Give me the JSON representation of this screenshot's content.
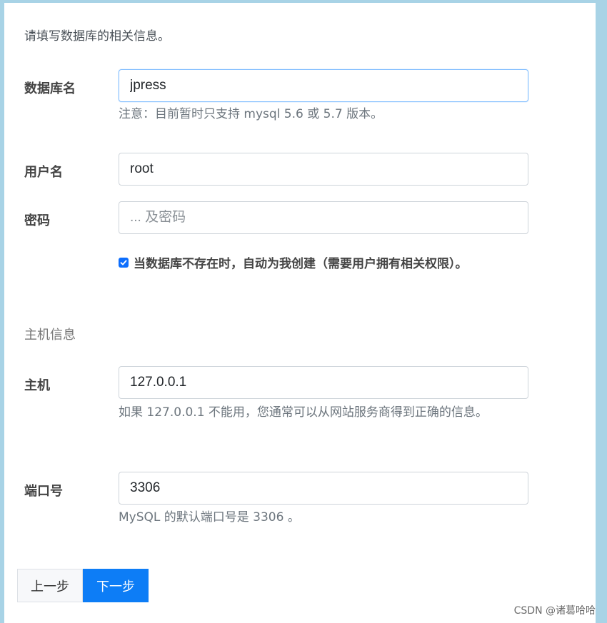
{
  "intro": "请填写数据库的相关信息。",
  "db": {
    "label": "数据库名",
    "value": "jpress",
    "help": "注意：目前暂时只支持 mysql 5.6 或 5.7 版本。"
  },
  "user": {
    "label": "用户名",
    "value": "root"
  },
  "password": {
    "label": "密码",
    "placeholder": "... 及密码"
  },
  "create_checkbox": {
    "checked": true,
    "label": "当数据库不存在时，自动为我创建（需要用户拥有相关权限）。"
  },
  "host_section": "主机信息",
  "host": {
    "label": "主机",
    "value": "127.0.0.1",
    "help": "如果 127.0.0.1 不能用，您通常可以从网站服务商得到正确的信息。"
  },
  "port": {
    "label": "端口号",
    "value": "3306",
    "help": "MySQL 的默认端口号是 3306 。"
  },
  "buttons": {
    "prev": "上一步",
    "next": "下一步"
  },
  "watermark": "CSDN @诸葛哈哈",
  "colors": {
    "primary": "#0d7df6",
    "background": "#a8d3e6"
  }
}
